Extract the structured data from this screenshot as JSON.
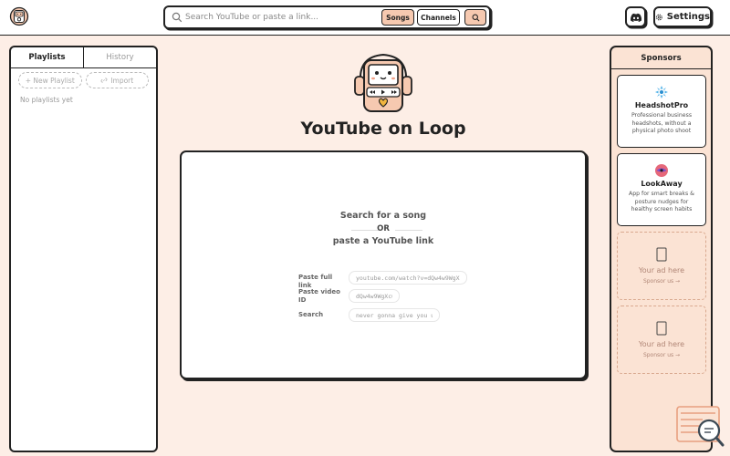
{
  "header": {
    "search_placeholder": "Search YouTube or paste a link...",
    "filters": {
      "songs": "Songs",
      "channels": "Channels",
      "active": "Songs"
    },
    "settings_label": "Settings"
  },
  "sidebar": {
    "tabs": [
      {
        "label": "Playlists",
        "active": true
      },
      {
        "label": "History",
        "active": false
      }
    ],
    "new_playlist": "+ New Playlist",
    "import": "Import",
    "empty_text": "No playlists yet"
  },
  "main": {
    "title": "YouTube on Loop",
    "prompt_line1": "Search for a song",
    "prompt_or": "OR",
    "prompt_line2": "paste a YouTube link",
    "form": [
      {
        "label": "Paste full link",
        "placeholder": "youtube.com/watch?v=dQw4w9WgXcQ"
      },
      {
        "label": "Paste video ID",
        "placeholder": "dQw4w9WgXcQ"
      },
      {
        "label": "Search",
        "placeholder": "never gonna give you up"
      }
    ]
  },
  "sponsors": {
    "title": "Sponsors",
    "items": [
      {
        "name": "HeadshotPro",
        "description": "Professional business headshots, without a physical photo shoot",
        "icon": "headshotpro-logo-icon"
      },
      {
        "name": "LookAway",
        "description": "App for smart breaks & posture nudges for healthy screen habits",
        "icon": "lookaway-logo-icon"
      }
    ],
    "ad_slots": [
      {
        "title": "Your ad here",
        "link": "Sponsor us →"
      },
      {
        "title": "Your ad here",
        "link": "Sponsor us →"
      }
    ]
  },
  "colors": {
    "background": "#fdeee6",
    "accent": "#f6c9b0",
    "sponsor_panel": "#fbe3d4",
    "border": "#222222"
  }
}
